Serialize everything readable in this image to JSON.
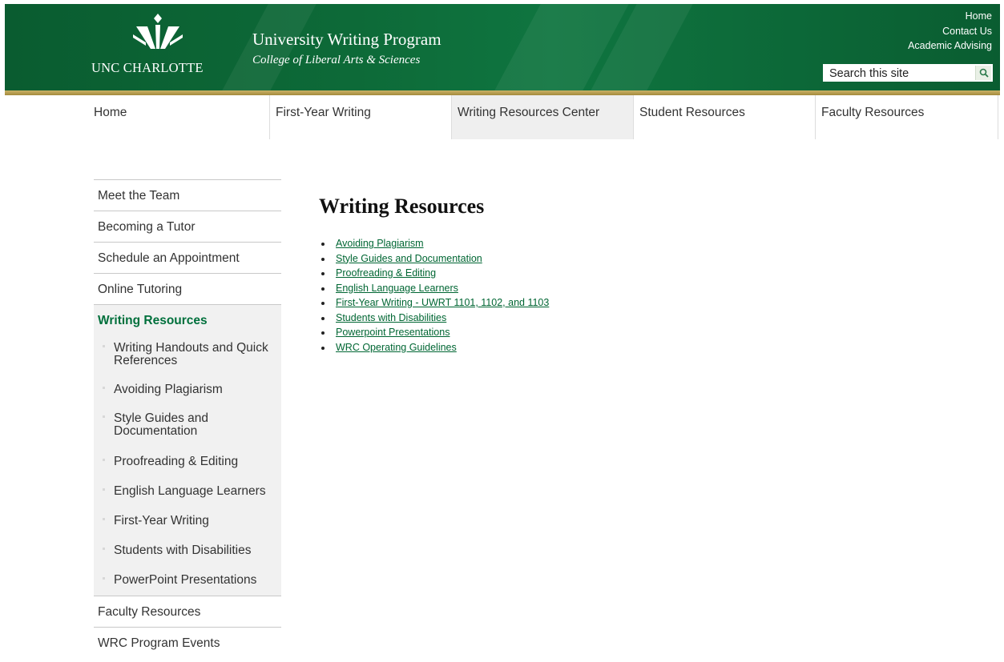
{
  "header": {
    "logo_text": "UNC CHARLOTTE",
    "site_title": "University Writing Program",
    "site_subtitle": "College of Liberal Arts & Sciences",
    "utility_links": [
      "Home",
      "Contact Us",
      "Academic Advising"
    ],
    "search_placeholder": "Search this site",
    "colors": {
      "header_green": "#0d6a38",
      "gold_bar": "#b89d4e",
      "link_green": "#006633"
    }
  },
  "main_nav": [
    {
      "label": "Home",
      "active": false
    },
    {
      "label": "First-Year Writing",
      "active": false
    },
    {
      "label": "Writing Resources Center",
      "active": true
    },
    {
      "label": "Student Resources",
      "active": false
    },
    {
      "label": "Faculty Resources",
      "active": false
    }
  ],
  "sidebar": {
    "items_before": [
      "Meet the Team",
      "Becoming a Tutor",
      "Schedule an Appointment",
      "Online Tutoring"
    ],
    "current": "Writing Resources",
    "sub_items": [
      "Writing Handouts and Quick References",
      "Avoiding Plagiarism",
      "Style Guides and Documentation",
      "Proofreading & Editing",
      "English Language Learners",
      "First-Year Writing",
      "Students with Disabilities",
      "PowerPoint Presentations"
    ],
    "items_after": [
      "Faculty Resources",
      "WRC Program Events"
    ]
  },
  "content": {
    "heading": "Writing Resources",
    "links": [
      "Avoiding Plagiarism",
      "Style Guides and Documentation",
      "Proofreading & Editing",
      "English Language Learners",
      "First-Year Writing - UWRT 1101, 1102, and 1103",
      "Students with Disabilities",
      "Powerpoint Presentations",
      "WRC Operating Guidelines"
    ]
  }
}
